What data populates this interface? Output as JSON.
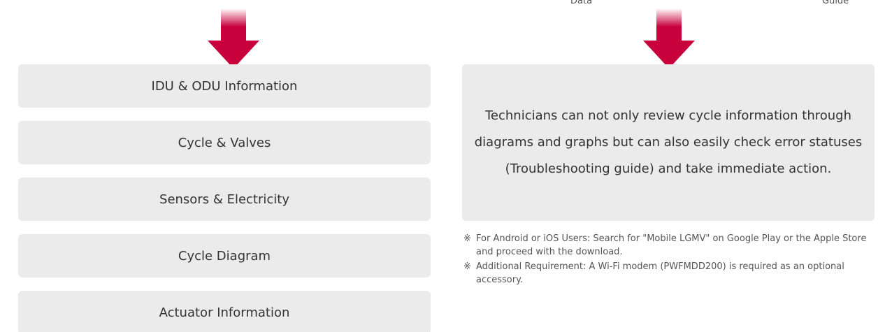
{
  "top_labels": {
    "left": "Data",
    "right": "Guide"
  },
  "colors": {
    "arrow": "#c8003c",
    "panel_bg": "#ebebeb",
    "text": "#333333"
  },
  "features": [
    {
      "label": "IDU & ODU Information"
    },
    {
      "label": "Cycle & Valves"
    },
    {
      "label": "Sensors & Electricity"
    },
    {
      "label": "Cycle Diagram"
    },
    {
      "label": "Actuator Information"
    }
  ],
  "description": {
    "line1": "Technicians can not only review cycle information through",
    "line2": "diagrams and graphs but can also easily check error statuses",
    "line3": "(Troubleshooting guide) and take immediate action."
  },
  "notes": [
    {
      "mark": "※",
      "text": "For Android or iOS Users: Search for \"Mobile LGMV\" on Google Play or the Apple Store and proceed with the download."
    },
    {
      "mark": "※",
      "text": "Additional Requirement: A Wi-Fi modem (PWFMDD200) is required as an optional accessory."
    }
  ]
}
